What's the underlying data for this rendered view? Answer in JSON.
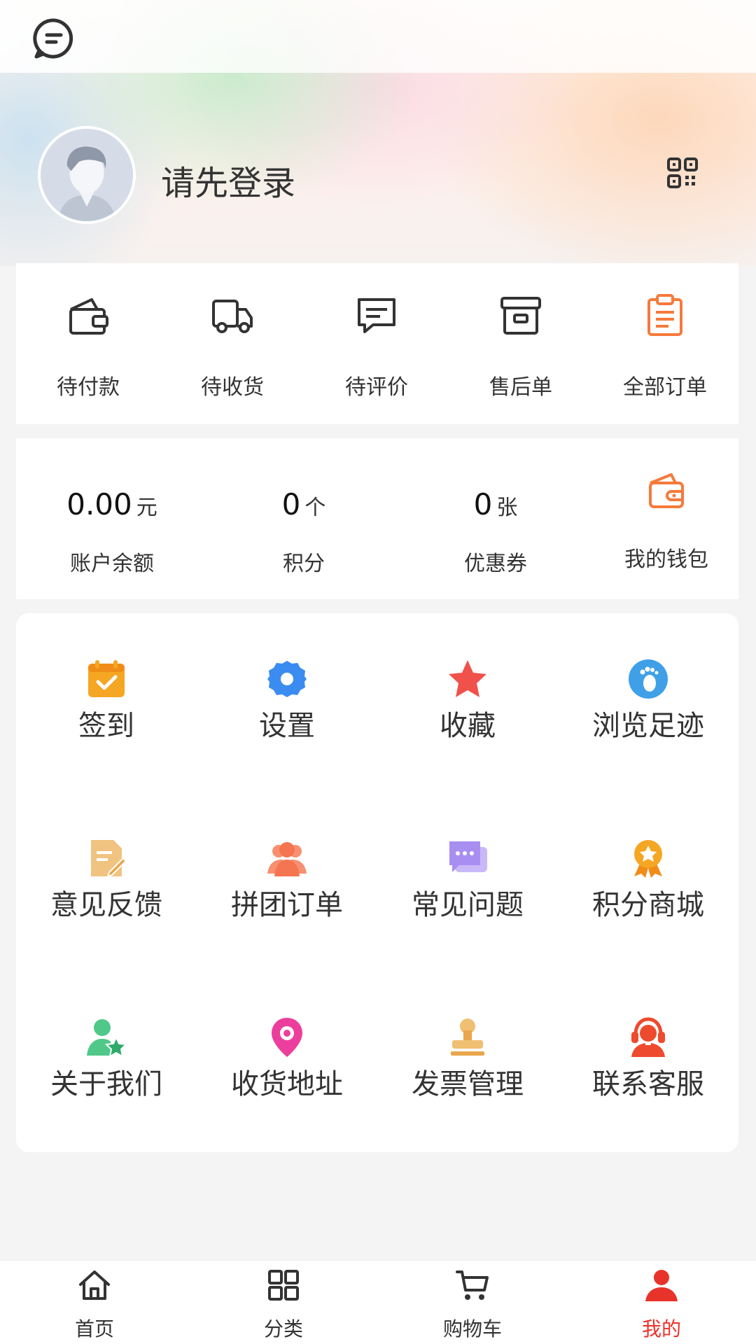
{
  "profile": {
    "login_prompt": "请先登录"
  },
  "orders": [
    {
      "label": "待付款",
      "icon": "wallet-icon"
    },
    {
      "label": "待收货",
      "icon": "truck-icon"
    },
    {
      "label": "待评价",
      "icon": "comment-icon"
    },
    {
      "label": "售后单",
      "icon": "archive-box-icon"
    },
    {
      "label": "全部订单",
      "icon": "clipboard-icon"
    }
  ],
  "assets": {
    "balance": {
      "value": "0.00",
      "unit": "元",
      "label": "账户余额"
    },
    "points": {
      "value": "0",
      "unit": "个",
      "label": "积分"
    },
    "coupons": {
      "value": "0",
      "unit": "张",
      "label": "优惠券"
    },
    "wallet": {
      "label": "我的钱包",
      "icon": "wallet-icon"
    }
  },
  "services": [
    {
      "label": "签到",
      "icon": "calendar-check-icon",
      "color": "#f5a623"
    },
    {
      "label": "设置",
      "icon": "gear-icon",
      "color": "#3b8cf0"
    },
    {
      "label": "收藏",
      "icon": "star-icon",
      "color": "#f0514a"
    },
    {
      "label": "浏览足迹",
      "icon": "footprint-icon",
      "color": "#3fa0e8"
    },
    {
      "label": "意见反馈",
      "icon": "feedback-note-icon",
      "color": "#f0c380"
    },
    {
      "label": "拼团订单",
      "icon": "group-icon",
      "color": "#f57550"
    },
    {
      "label": "常见问题",
      "icon": "chat-bubbles-icon",
      "color": "#a98ef2"
    },
    {
      "label": "积分商城",
      "icon": "award-medal-icon",
      "color": "#f5a623"
    },
    {
      "label": "关于我们",
      "icon": "user-star-icon",
      "color": "#4fc889"
    },
    {
      "label": "收货地址",
      "icon": "location-pin-icon",
      "color": "#ec3f9d"
    },
    {
      "label": "发票管理",
      "icon": "stamp-icon",
      "color": "#f0bf72"
    },
    {
      "label": "联系客服",
      "icon": "headset-user-icon",
      "color": "#ee4a2d"
    }
  ],
  "tabbar": [
    {
      "label": "首页",
      "icon": "home-icon"
    },
    {
      "label": "分类",
      "icon": "grid-icon"
    },
    {
      "label": "购物车",
      "icon": "cart-icon"
    },
    {
      "label": "我的",
      "icon": "user-icon",
      "active": true
    }
  ],
  "colors": {
    "accent": "#e8332a",
    "order_all_icon": "#f57a3a"
  }
}
